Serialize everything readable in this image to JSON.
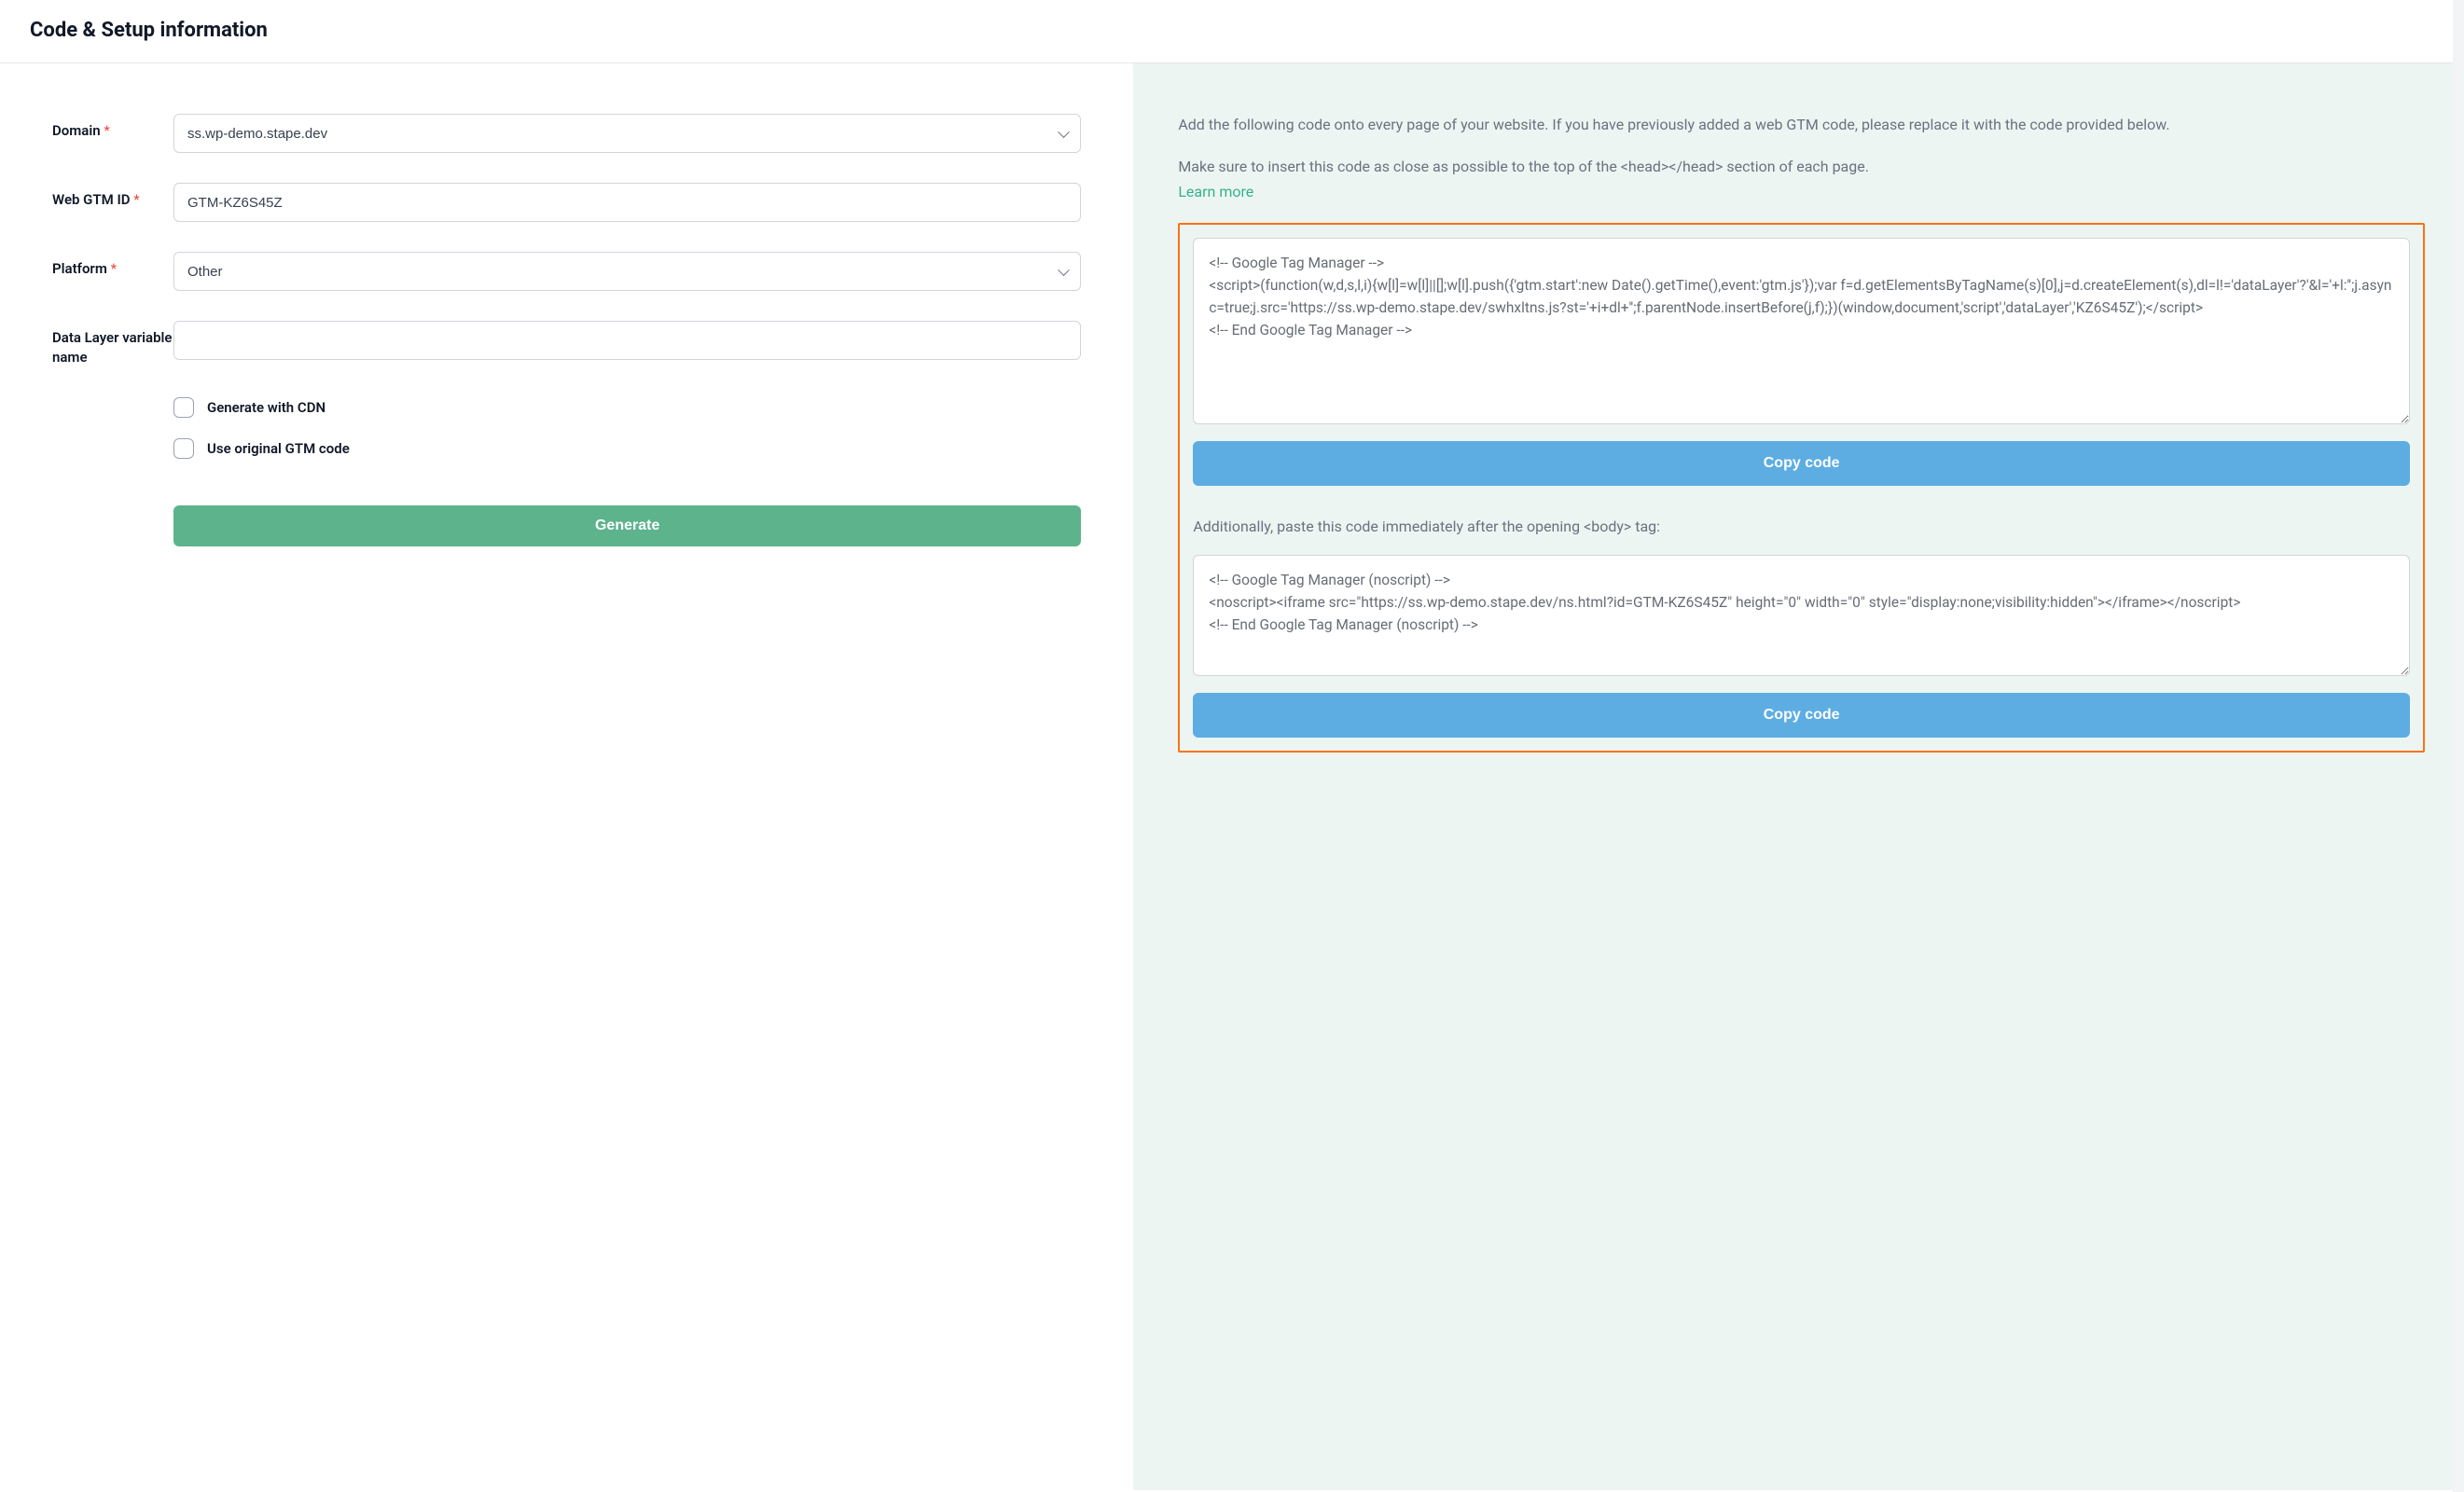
{
  "header": {
    "title": "Code & Setup information"
  },
  "form": {
    "domain": {
      "label": "Domain",
      "required": "*",
      "value": "ss.wp-demo.stape.dev"
    },
    "webGtmId": {
      "label": "Web GTM ID",
      "required": "*",
      "value": "GTM-KZ6S45Z"
    },
    "platform": {
      "label": "Platform",
      "required": "*",
      "value": "Other"
    },
    "dataLayer": {
      "label": "Data Layer variable name",
      "value": ""
    },
    "checkCdn": {
      "label": "Generate with CDN"
    },
    "checkOriginal": {
      "label": "Use original GTM code"
    },
    "generateBtn": "Generate"
  },
  "right": {
    "instr1": "Add the following code onto every page of your website. If you have previously added a web GTM code, please replace it with the code provided below.",
    "instr2": "Make sure to insert this code as close as possible to the top of the <head></head> section of each page.",
    "learnMore": "Learn more",
    "code1": "<!-- Google Tag Manager -->\n<script>(function(w,d,s,l,i){w[l]=w[l]||[];w[l].push({'gtm.start':new Date().getTime(),event:'gtm.js'});var f=d.getElementsByTagName(s)[0],j=d.createElement(s),dl=l!='dataLayer'?'&l='+l:'';j.async=true;j.src='https://ss.wp-demo.stape.dev/swhxltns.js?st='+i+dl+'';f.parentNode.insertBefore(j,f);})(window,document,'script','dataLayer','KZ6S45Z');</script>\n<!-- End Google Tag Manager -->",
    "copy1": "Copy code",
    "instr3": "Additionally, paste this code immediately after the opening <body> tag:",
    "code2": "<!-- Google Tag Manager (noscript) -->\n<noscript><iframe src=\"https://ss.wp-demo.stape.dev/ns.html?id=GTM-KZ6S45Z\" height=\"0\" width=\"0\" style=\"display:none;visibility:hidden\"></iframe></noscript>\n<!-- End Google Tag Manager (noscript) -->",
    "copy2": "Copy code"
  }
}
